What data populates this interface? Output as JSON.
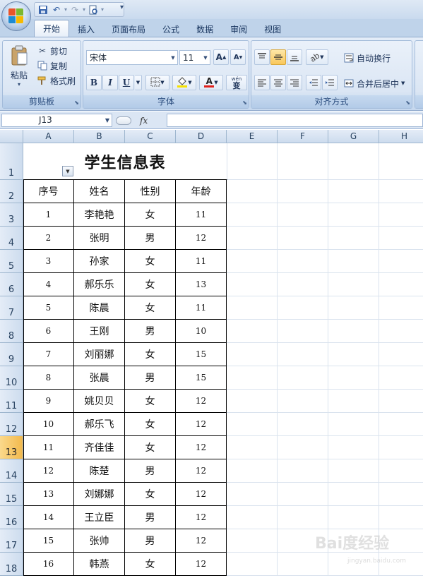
{
  "ribbon": {
    "tabs": [
      "开始",
      "插入",
      "页面布局",
      "公式",
      "数据",
      "审阅",
      "视图"
    ],
    "active_tab": "开始",
    "clipboard": {
      "paste": "粘贴",
      "cut": "剪切",
      "copy": "复制",
      "format_painter": "格式刷",
      "label": "剪贴板"
    },
    "font": {
      "name": "宋体",
      "size": "11",
      "label": "字体",
      "bold": "B",
      "italic": "I",
      "underline": "U",
      "phonetic": "wén\n变"
    },
    "alignment": {
      "wrap_text": "自动换行",
      "merge_center": "合并后居中",
      "label": "对齐方式"
    }
  },
  "formula_bar": {
    "name_box": "J13",
    "fx": "fx",
    "formula": ""
  },
  "sheet": {
    "columns": [
      "A",
      "B",
      "C",
      "D",
      "E",
      "F",
      "G",
      "H"
    ],
    "rows": [
      "1",
      "2",
      "3",
      "4",
      "5",
      "6",
      "7",
      "8",
      "9",
      "10",
      "11",
      "12",
      "13",
      "14",
      "15",
      "16",
      "17",
      "18"
    ],
    "active_row": "13",
    "title": "学生信息表",
    "headers": [
      "序号",
      "姓名",
      "性别",
      "年龄"
    ],
    "records": [
      [
        "1",
        "李艳艳",
        "女",
        "11"
      ],
      [
        "2",
        "张明",
        "男",
        "12"
      ],
      [
        "3",
        "孙家",
        "女",
        "11"
      ],
      [
        "4",
        "郝乐乐",
        "女",
        "13"
      ],
      [
        "5",
        "陈晨",
        "女",
        "11"
      ],
      [
        "6",
        "王刚",
        "男",
        "10"
      ],
      [
        "7",
        "刘丽娜",
        "女",
        "15"
      ],
      [
        "8",
        "张晨",
        "男",
        "15"
      ],
      [
        "9",
        "姚贝贝",
        "女",
        "12"
      ],
      [
        "10",
        "郝乐飞",
        "女",
        "12"
      ],
      [
        "11",
        "齐佳佳",
        "女",
        "12"
      ],
      [
        "12",
        "陈楚",
        "男",
        "12"
      ],
      [
        "13",
        "刘娜娜",
        "女",
        "12"
      ],
      [
        "14",
        "王立臣",
        "男",
        "12"
      ],
      [
        "15",
        "张帅",
        "男",
        "12"
      ],
      [
        "16",
        "韩燕",
        "女",
        "12"
      ]
    ]
  },
  "colors": {
    "ribbon_bg": "#d5e3f4",
    "header_bg": "#cddcee",
    "active_row_header": "#f2b94c",
    "highlight": "#f9c75a"
  },
  "watermark": {
    "text": "Bai度经验",
    "sub": "jingyan.baidu.com"
  }
}
